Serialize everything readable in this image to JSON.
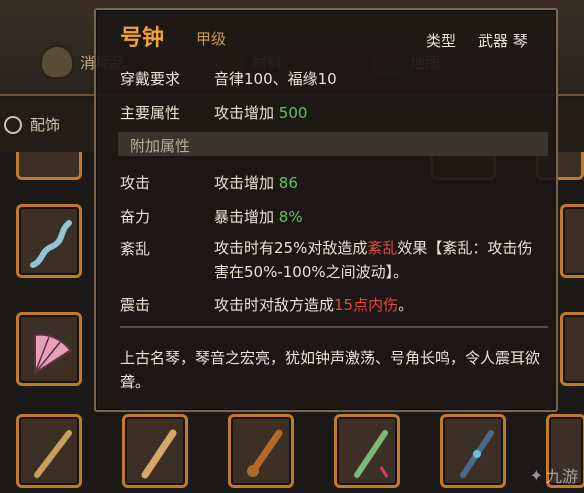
{
  "tabs": [
    {
      "label": "消耗品",
      "icon": "potion-icon"
    },
    {
      "label": "材料",
      "icon": "material-icon"
    },
    {
      "label": "地图",
      "icon": "map-icon"
    }
  ],
  "filter": {
    "label": "配饰"
  },
  "tooltip": {
    "name": "号钟",
    "grade": "甲级",
    "type_label": "类型",
    "type_value": "武器 琴",
    "requirement_label": "穿戴要求",
    "requirement_value": "音律100、福缘10",
    "main_attr_label": "主要属性",
    "main_attr_text": "攻击增加",
    "main_attr_value": "500",
    "extra_section": "附加属性",
    "attack_label": "攻击",
    "attack_text": "攻击增加",
    "attack_value": "86",
    "fury_label": "奋力",
    "fury_text": "暴击增加",
    "fury_value": "8%",
    "chaos_label": "紊乱",
    "chaos_pre": "攻击时有25%对敌造成",
    "chaos_keyword": "紊乱",
    "chaos_post": "效果【紊乱：攻击伤害在50%-100%之间波动】。",
    "shock_label": "震击",
    "shock_pre": "攻击时对敌方造成",
    "shock_highlight": "15点内伤",
    "shock_post": "。",
    "flavor": "上古名琴，琴音之宏亮，犹如钟声激荡、号角长鸣，令人震耳欲聋。"
  },
  "watermark": "九游",
  "colors": {
    "name": "#f0a23a",
    "positive": "#62c25a",
    "highlight": "#e24848",
    "slot_border": "#c27a2a"
  }
}
